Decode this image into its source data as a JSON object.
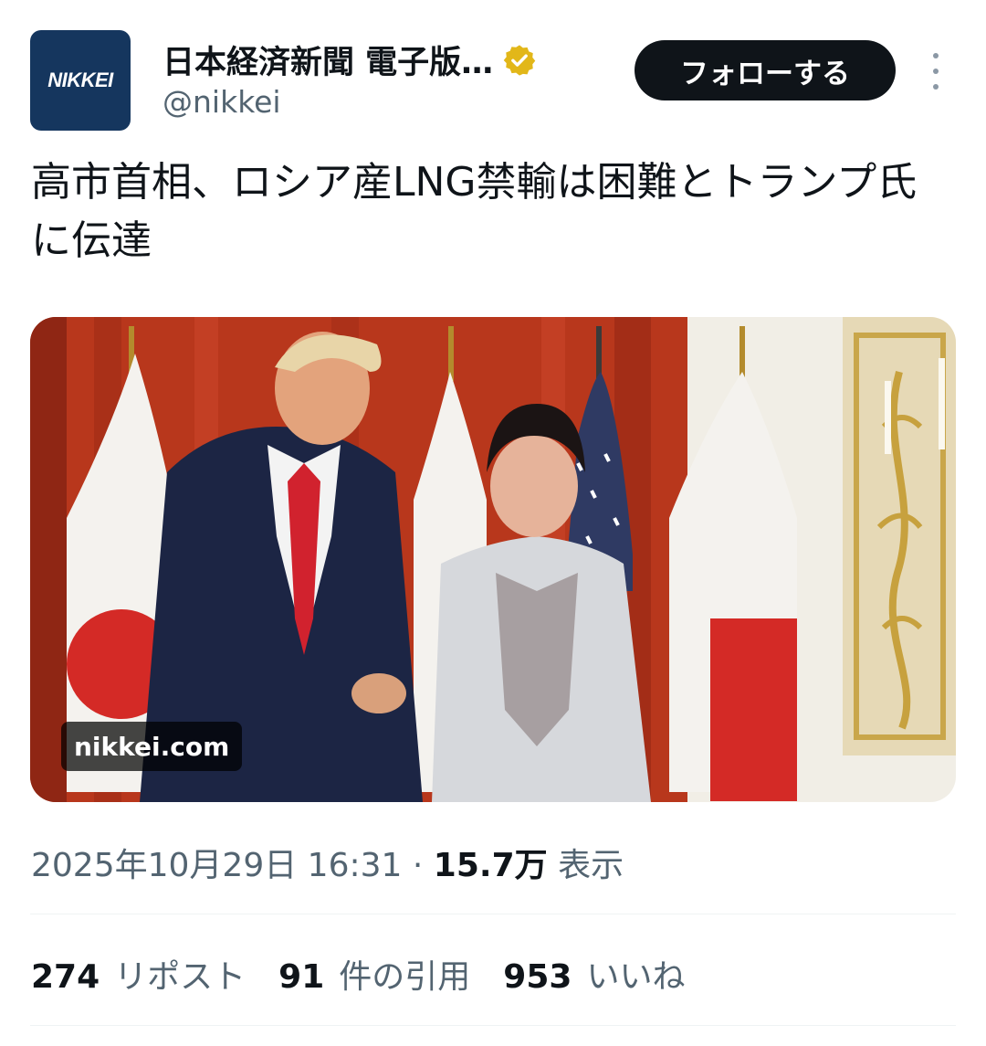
{
  "author": {
    "avatar_text": "NIKKEI",
    "display_name": "日本経済新聞 電子版…",
    "handle": "@nikkei",
    "verified_icon": "verified-badge-icon",
    "verified_color": "#e2b719"
  },
  "actions": {
    "follow_label": "フォローする",
    "more_icon": "more-vertical-icon"
  },
  "tweet": {
    "text": "高市首相、ロシア産LNG禁輸は困難とトランプ氏に伝達"
  },
  "media": {
    "source_label": "nikkei.com"
  },
  "meta": {
    "timestamp": "2025年10月29日 16:31",
    "separator": "·",
    "views_count": "15.7万",
    "views_label": "表示"
  },
  "stats": {
    "reposts_count": "274",
    "reposts_label": "リポスト",
    "quotes_count": "91",
    "quotes_label": "件の引用",
    "likes_count": "953",
    "likes_label": "いいね"
  },
  "colors": {
    "text_primary": "#0f1419",
    "text_secondary": "#536471",
    "button_bg": "#0f1419",
    "avatar_bg": "#15365e"
  }
}
